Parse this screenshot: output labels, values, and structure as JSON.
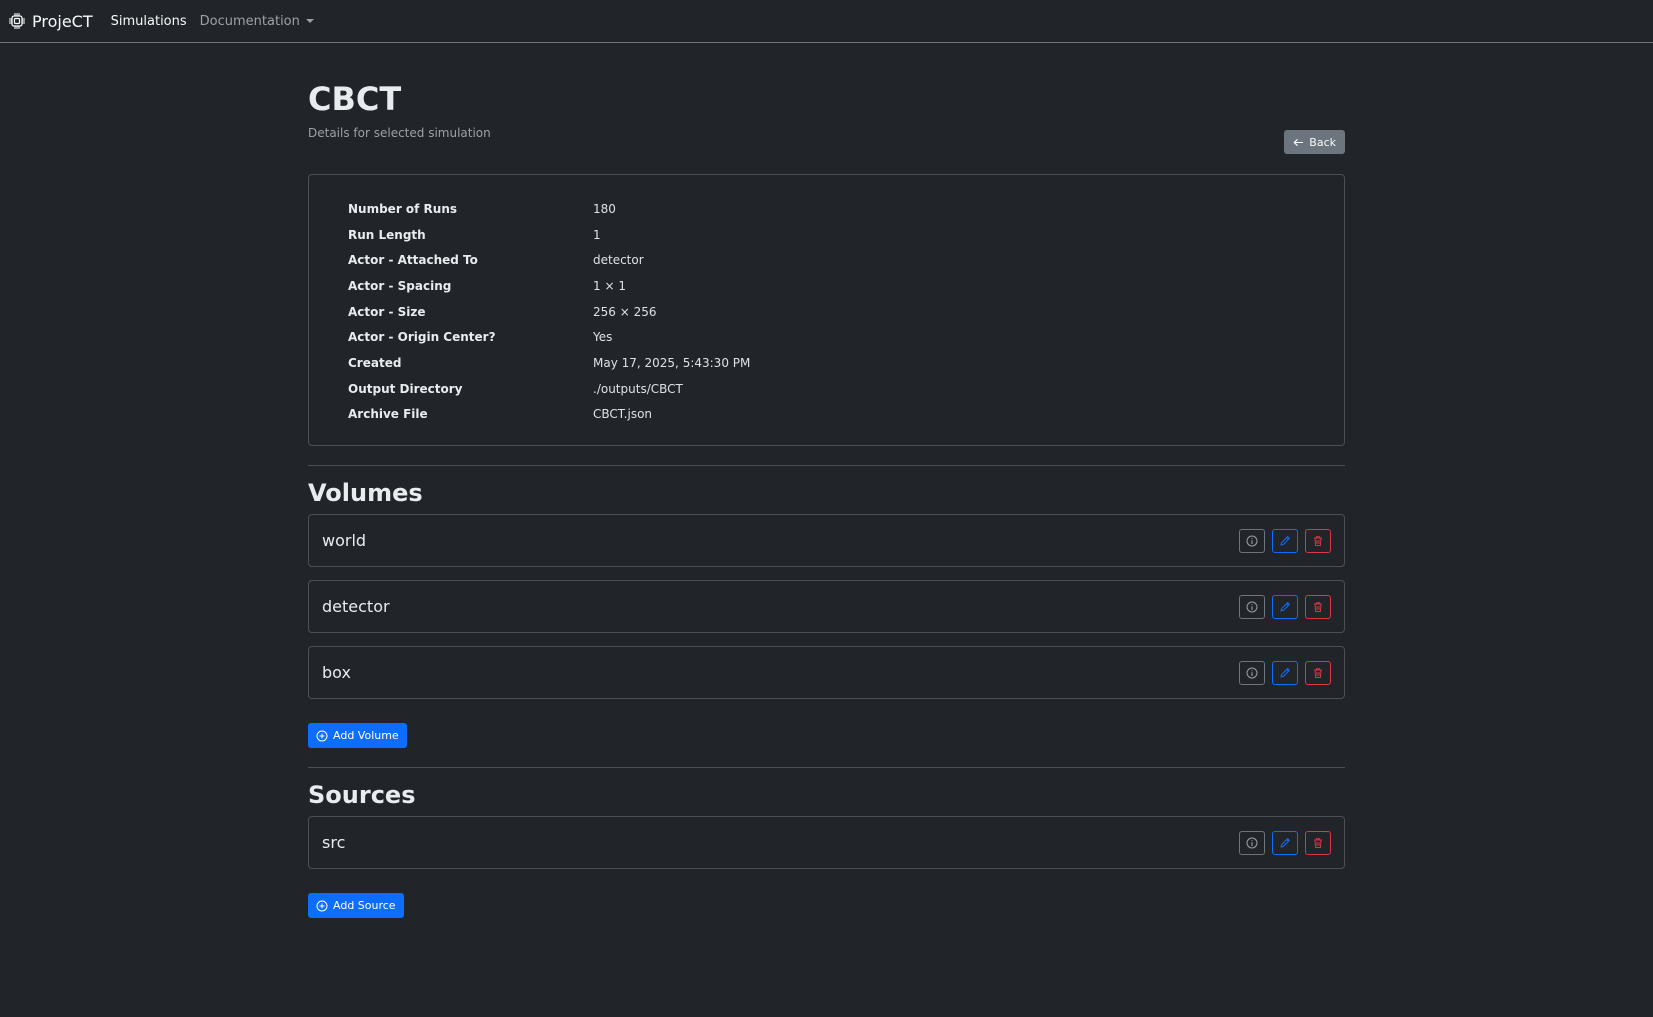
{
  "navbar": {
    "brand": "ProjeCT",
    "links": {
      "simulations": "Simulations",
      "documentation": "Documentation"
    }
  },
  "header": {
    "title": "CBCT",
    "subtitle": "Details for selected simulation",
    "back_label": "Back"
  },
  "details": [
    {
      "label": "Number of Runs",
      "value": "180"
    },
    {
      "label": "Run Length",
      "value": "1"
    },
    {
      "label": "Actor - Attached To",
      "value": "detector"
    },
    {
      "label": "Actor - Spacing",
      "value": "1 × 1"
    },
    {
      "label": "Actor - Size",
      "value": "256 × 256"
    },
    {
      "label": "Actor - Origin Center?",
      "value": "Yes"
    },
    {
      "label": "Created",
      "value": "May 17, 2025, 5:43:30 PM"
    },
    {
      "label": "Output Directory",
      "value": "./outputs/CBCT"
    },
    {
      "label": "Archive File",
      "value": "CBCT.json"
    }
  ],
  "volumes": {
    "title": "Volumes",
    "items": [
      {
        "name": "world"
      },
      {
        "name": "detector"
      },
      {
        "name": "box"
      }
    ],
    "add_label": "Add Volume"
  },
  "sources": {
    "title": "Sources",
    "items": [
      {
        "name": "src"
      }
    ],
    "add_label": "Add Source"
  },
  "colors": {
    "background": "#212529",
    "primary": "#0d6efd",
    "danger": "#dc3545",
    "secondary": "#6c757d"
  },
  "icons": {
    "brand": "cpu-icon",
    "back": "arrow-left-icon",
    "info": "info-circle-icon",
    "edit": "pencil-icon",
    "delete": "trash-icon",
    "add": "plus-circle-icon"
  }
}
